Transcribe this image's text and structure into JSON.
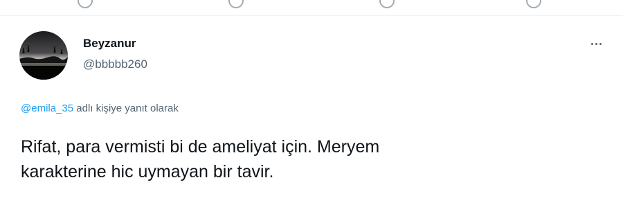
{
  "author": {
    "display_name": "Beyzanur",
    "handle": "@bbbbb260"
  },
  "reply_context": {
    "mention": "@emila_35",
    "suffix": "adlı kişiye yanıt olarak"
  },
  "tweet": {
    "lines": [
      "Rifat, para vermisti bi de ameliyat için. Meryem",
      "karakterine hic uymayan bir tavir."
    ]
  },
  "icons": {
    "top_actions": [
      "reply-icon",
      "retweet-icon",
      "like-icon",
      "share-icon"
    ],
    "more": "more-options-icon"
  },
  "colors": {
    "link": "#1d9bf0",
    "secondary_text": "#536471",
    "primary_text": "#0f1419"
  }
}
